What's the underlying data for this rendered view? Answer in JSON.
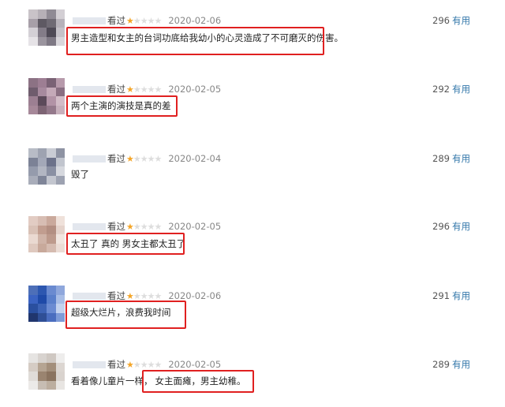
{
  "reviews": [
    {
      "watched_label": "看过",
      "stars_total": 5,
      "stars_filled": 1,
      "date": "2020-02-06",
      "votes": "296",
      "useful_label": "有用",
      "comment_pre": "",
      "comment_highlight": "男主造型和女主的台词功底给我幼小的心灵造成了不可磨灭的伤害。",
      "avatar_colors": [
        "#c9c3c8",
        "#b6b0b7",
        "#8f8a94",
        "#d3cfd4",
        "#a79fa8",
        "#5e5963",
        "#6f6a74",
        "#b7b2ba",
        "#d4d0d6",
        "#837c88",
        "#4f4a56",
        "#c5c1c8",
        "#e6e3e7",
        "#9a949e",
        "#7e7884",
        "#d9d6db"
      ]
    },
    {
      "watched_label": "看过",
      "stars_total": 5,
      "stars_filled": 1,
      "date": "2020-02-05",
      "votes": "292",
      "useful_label": "有用",
      "comment_pre": "",
      "comment_highlight": "两个主演的演技是真的差",
      "avatar_colors": [
        "#8c7284",
        "#9d7e93",
        "#7a6275",
        "#b79aab",
        "#6f5c6d",
        "#a78a9e",
        "#c4a9b8",
        "#8a6f82",
        "#9c7f92",
        "#5c4a5a",
        "#b293a6",
        "#d2bcc7",
        "#a68899",
        "#7d6474",
        "#94798b",
        "#c7b0bc"
      ]
    },
    {
      "watched_label": "看过",
      "stars_total": 5,
      "stars_filled": 1,
      "date": "2020-02-04",
      "votes": "289",
      "useful_label": "有用",
      "comment_pre": "毁了",
      "comment_highlight": "",
      "avatar_colors": [
        "#b8bcc6",
        "#9ea3b1",
        "#c9ccd4",
        "#8e93a3",
        "#7c8296",
        "#a3a8b8",
        "#6c728a",
        "#c1c5ce",
        "#959bac",
        "#b2b6c2",
        "#8a90a3",
        "#d6d8de",
        "#a9adba",
        "#7f8598",
        "#c3c6cf",
        "#9da2b1"
      ]
    },
    {
      "watched_label": "看过",
      "stars_total": 5,
      "stars_filled": 1,
      "date": "2020-02-05",
      "votes": "296",
      "useful_label": "有用",
      "comment_pre": "",
      "comment_highlight": "太丑了 真的 男女主都太丑了",
      "avatar_colors": [
        "#e2ccc3",
        "#d7bdb3",
        "#caa99c",
        "#efe1da",
        "#d9c1b6",
        "#c19d8f",
        "#b38f82",
        "#e5d3cb",
        "#ead9d1",
        "#cfb3a7",
        "#bd9a8c",
        "#f1e6e0",
        "#dfc9bf",
        "#c8a99b",
        "#d5bbb0",
        "#ebdcd5"
      ]
    },
    {
      "watched_label": "看过",
      "stars_total": 5,
      "stars_filled": 1,
      "date": "2020-02-06",
      "votes": "291",
      "useful_label": "有用",
      "comment_pre": "",
      "comment_highlight": "超级大烂片，浪费我时间",
      "avatar_colors": [
        "#4d6fb8",
        "#2d57b0",
        "#6a8ad0",
        "#8fa7dc",
        "#3b63c2",
        "#1f4aa8",
        "#5a7fcb",
        "#a8bde6",
        "#2a4f9f",
        "#3d63b5",
        "#6b8bd2",
        "#c3d2ef",
        "#20366e",
        "#2f4f96",
        "#4a6dbf",
        "#7e9bd8"
      ]
    },
    {
      "watched_label": "看过",
      "stars_total": 5,
      "stars_filled": 1,
      "date": "2020-02-05",
      "votes": "289",
      "useful_label": "有用",
      "comment_pre": "看着像儿童片一样，",
      "comment_highlight": "女主面瘫，男主幼稚。",
      "avatar_colors": [
        "#e6e4e2",
        "#d8d3cf",
        "#cfc8c2",
        "#eeedec",
        "#d5ccc4",
        "#b5a492",
        "#a38f7b",
        "#dcd6d1",
        "#e0dcd8",
        "#9a8470",
        "#8a735f",
        "#d9d3ce",
        "#eceae8",
        "#c7bdb3",
        "#bcae9f",
        "#e8e5e2"
      ]
    }
  ]
}
